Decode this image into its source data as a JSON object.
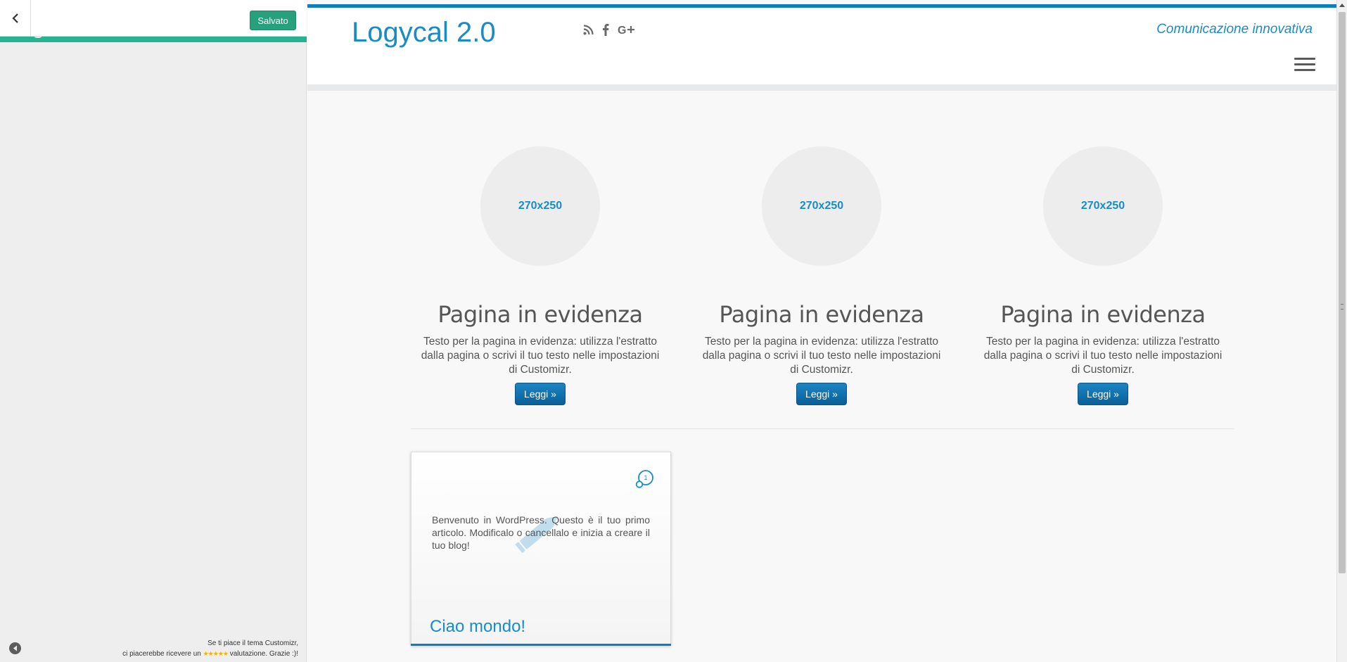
{
  "customizer": {
    "save_label": "Salvato",
    "footer": {
      "line1": "Se ti piace il tema Customizr,",
      "line2_prefix": "ci piacerebbe ricevere un",
      "stars": "★★★★★",
      "line2_suffix": "valutazione. Grazie :)!"
    }
  },
  "site": {
    "title": "Logycal 2.0",
    "tagline": "Comunicazione innovativa",
    "social_icons": [
      "rss-icon",
      "facebook-icon",
      "google-plus-icon"
    ]
  },
  "featured": [
    {
      "thumb": "270x250",
      "title": "Pagina in evidenza",
      "text": "Testo per la pagina in evidenza: utilizza l'estratto dalla pagina o scrivi il tuo testo nelle impostazioni di Customizr.",
      "button": "Leggi »"
    },
    {
      "thumb": "270x250",
      "title": "Pagina in evidenza",
      "text": "Testo per la pagina in evidenza: utilizza l'estratto dalla pagina o scrivi il tuo testo nelle impostazioni di Customizr.",
      "button": "Leggi »"
    },
    {
      "thumb": "270x250",
      "title": "Pagina in evidenza",
      "text": "Testo per la pagina in evidenza: utilizza l'estratto dalla pagina o scrivi il tuo testo nelle impostazioni di Customizr.",
      "button": "Leggi »"
    }
  ],
  "post": {
    "comment_count": "1",
    "excerpt": "Benvenuto in WordPress. Questo è il tuo primo articolo. Modificalo o cancellalo e inizia a creare il tuo blog!",
    "title": "Ciao mondo!"
  },
  "colors": {
    "accent": "#1a8bc9",
    "save_green": "#27a17c",
    "customizer_bar": "#27b38f"
  }
}
